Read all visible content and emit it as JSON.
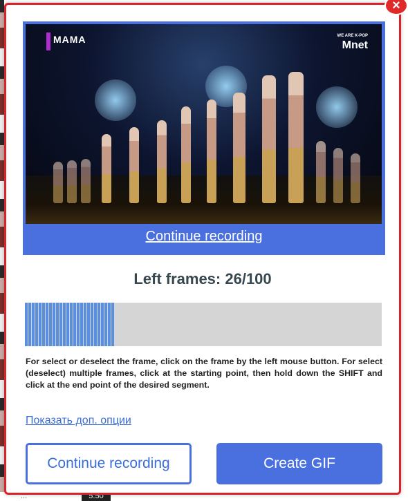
{
  "dialog": {
    "close_icon": "×",
    "preview": {
      "video_logo_left": "MAMA",
      "video_logo_right_small": "WE ARE K-POP",
      "video_logo_right": "Mnet",
      "continue_link": "Continue recording"
    },
    "frames_label": "Left frames: 26/100",
    "selected_frames": 26,
    "total_frames": 100,
    "help_text": "For select or deselect the frame, click on the frame by the left mouse button. For select (deselect) multiple frames, click at the starting point, then hold down the SHIFT and click at the end point of the desired segment.",
    "options_link": "Показать доп. опции",
    "buttons": {
      "continue_label": "Continue recording",
      "create_label": "Create GIF"
    }
  },
  "background": {
    "bottom_text": "...",
    "bottom_tag": "5:50"
  },
  "colors": {
    "accent": "#4a6fde",
    "border": "#d8232a",
    "frame_selected": "#5a8fde",
    "timeline_bg": "#d5d5d5"
  }
}
